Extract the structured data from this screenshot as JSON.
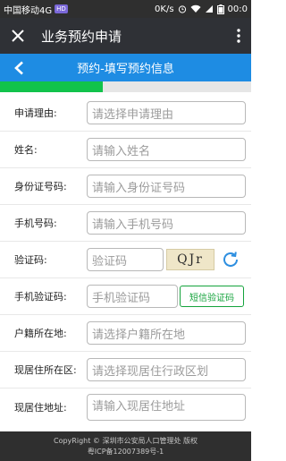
{
  "status_bar": {
    "carrier": "中国移动4G",
    "hd_badge": "HD",
    "speed": "0K/s",
    "battery_text": "",
    "time": "00:0"
  },
  "app_bar": {
    "title": "业务预约申请"
  },
  "page_header": {
    "title": "预约-填写预约信息"
  },
  "progress": {
    "fraction": 0.41,
    "fill_color": "#11c34b"
  },
  "form": {
    "reason": {
      "label": "申请理由:",
      "placeholder": "请选择申请理由"
    },
    "name": {
      "label": "姓名:",
      "placeholder": "请输入姓名"
    },
    "id_number": {
      "label": "身份证号码:",
      "placeholder": "请输入身份证号码"
    },
    "phone": {
      "label": "手机号码:",
      "placeholder": "请输入手机号码"
    },
    "captcha": {
      "label": "验证码:",
      "placeholder": "验证码",
      "image_text": "QJr"
    },
    "sms_code": {
      "label": "手机验证码:",
      "placeholder": "手机验证码",
      "button_label": "短信验证码"
    },
    "household_location": {
      "label": "户籍所在地:",
      "placeholder": "请选择户籍所在地"
    },
    "residence_district": {
      "label": "现居住所在区:",
      "placeholder": "请选择现居住行政区划"
    },
    "residence_address": {
      "label": "现居住地址:",
      "placeholder": "请输入现居住地址"
    }
  },
  "footer": {
    "copyright": "CopyRight © 深圳市公安局人口管理处 版权",
    "icp": "粤ICP备12007389号-1"
  },
  "colors": {
    "header_blue": "#1e8ce3",
    "progress_green": "#11c34b",
    "sms_green": "#14a33c",
    "refresh_blue": "#2e8fe0"
  },
  "icons": [
    "close-icon",
    "more-vertical-icon",
    "back-arrow-icon",
    "refresh-icon",
    "wifi-icon",
    "signal-icon",
    "battery-icon",
    "alarm-icon"
  ]
}
